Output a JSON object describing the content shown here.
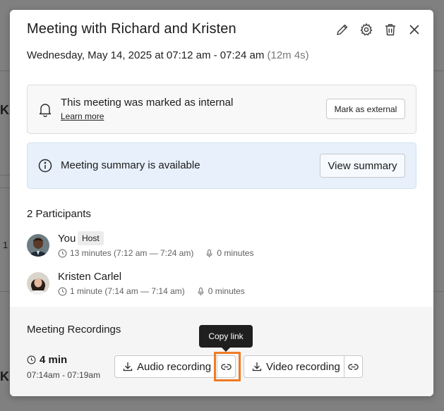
{
  "background": {
    "fragments": [
      "Kr",
      "1",
      "Kr"
    ]
  },
  "dialog": {
    "title": "Meeting with Richard and Kristen",
    "icons": [
      "edit-icon",
      "settings-icon",
      "trash-icon",
      "close-icon"
    ],
    "datetime": "Wednesday, May 14, 2025 at 07:12 am - 07:24 am",
    "duration": "(12m 4s)"
  },
  "internal_notice": {
    "title": "This meeting was marked as internal",
    "learn_more": "Learn more",
    "button": "Mark as external"
  },
  "summary_notice": {
    "title": "Meeting summary is available",
    "button": "View summary"
  },
  "participants": {
    "title": "2 Participants",
    "items": [
      {
        "name": "You",
        "badge": "Host",
        "time": "13 minutes (7:12 am — 7:24 am)",
        "mic": "0 minutes"
      },
      {
        "name": "Kristen Carlel",
        "time": "1 minute (7:14 am — 7:14 am)",
        "mic": "0 minutes"
      }
    ]
  },
  "recordings": {
    "title": "Meeting Recordings",
    "duration": "4 min",
    "time_range": "07:14am - 07:19am",
    "audio_label": "Audio recording",
    "video_label": "Video recording",
    "tooltip": "Copy link"
  },
  "colors": {
    "highlight": "#ef7b25",
    "summary_bg": "#e7f0fb",
    "tooltip_bg": "#1f1f1f"
  }
}
